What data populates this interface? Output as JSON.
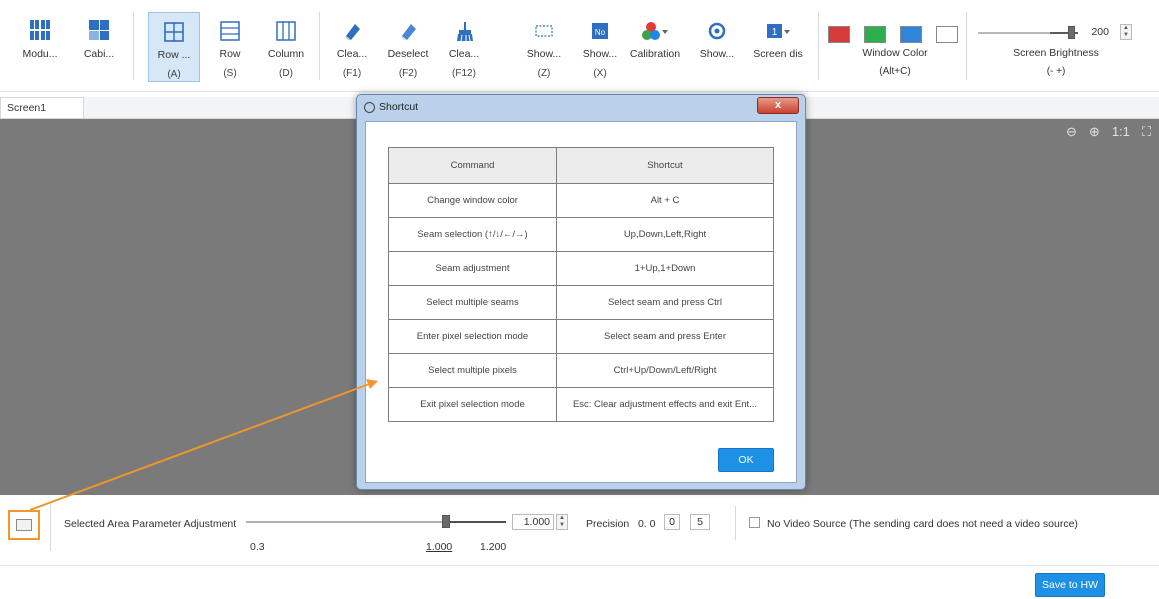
{
  "toolbar": {
    "buttons": [
      {
        "label": "Modu...",
        "key": ""
      },
      {
        "label": "Cabi...",
        "key": ""
      },
      {
        "label": "Row ...",
        "key": "(A)"
      },
      {
        "label": "Row",
        "key": "(S)"
      },
      {
        "label": "Column",
        "key": "(D)"
      },
      {
        "label": "Clea...",
        "key": "(F1)"
      },
      {
        "label": "Deselect",
        "key": "(F2)"
      },
      {
        "label": "Clea...",
        "key": "(F12)"
      },
      {
        "label": "Show...",
        "key": "(Z)"
      },
      {
        "label": "Show...",
        "key": "(X)"
      },
      {
        "label": "Calibration",
        "key": ""
      },
      {
        "label": "Show...",
        "key": ""
      },
      {
        "label": "Screen dis",
        "key": ""
      }
    ],
    "window_color": {
      "label": "Window Color",
      "key": "(Alt+C)",
      "swatches": [
        "#d63a3a",
        "#2fae4e",
        "#2d86d9",
        "#ffffff"
      ]
    },
    "brightness": {
      "label": "Screen Brightness",
      "key": "(- +)",
      "value": "200",
      "level": 0.78
    }
  },
  "screen_tab": "Screen1",
  "dialog": {
    "title": "Shortcut",
    "close": "x",
    "columns": [
      "Command",
      "Shortcut"
    ],
    "rows": [
      [
        "Change window color",
        "Alt + C"
      ],
      [
        "Seam selection (↑/↓/←/→)",
        "Up,Down,Left,Right"
      ],
      [
        "Seam adjustment",
        "1+Up,1+Down"
      ],
      [
        "Select multiple seams",
        "Select seam and press Ctrl"
      ],
      [
        "Enter pixel selection mode",
        "Select seam and press Enter"
      ],
      [
        "Select multiple pixels",
        "Ctrl+Up/Down/Left/Right"
      ],
      [
        "Exit pixel selection mode",
        "Esc: Clear adjustment effects and exit Ent..."
      ]
    ],
    "ok": "OK"
  },
  "bottom": {
    "label": "Selected Area Parameter Adjustment",
    "value": "1.000",
    "min": "0.3",
    "mid": "1.000",
    "max": "1.200",
    "precision_label": "Precision",
    "precision_prefix": "0. 0",
    "precision_digit_a": "0",
    "precision_digit_b": "5",
    "no_video": "No Video Source (The sending card does not need a video source)",
    "save": "Save to HW"
  },
  "canvas_tools": {
    "zoom_out": "−",
    "zoom_in": "+",
    "ratio": "1:1",
    "fit": "⌗"
  }
}
